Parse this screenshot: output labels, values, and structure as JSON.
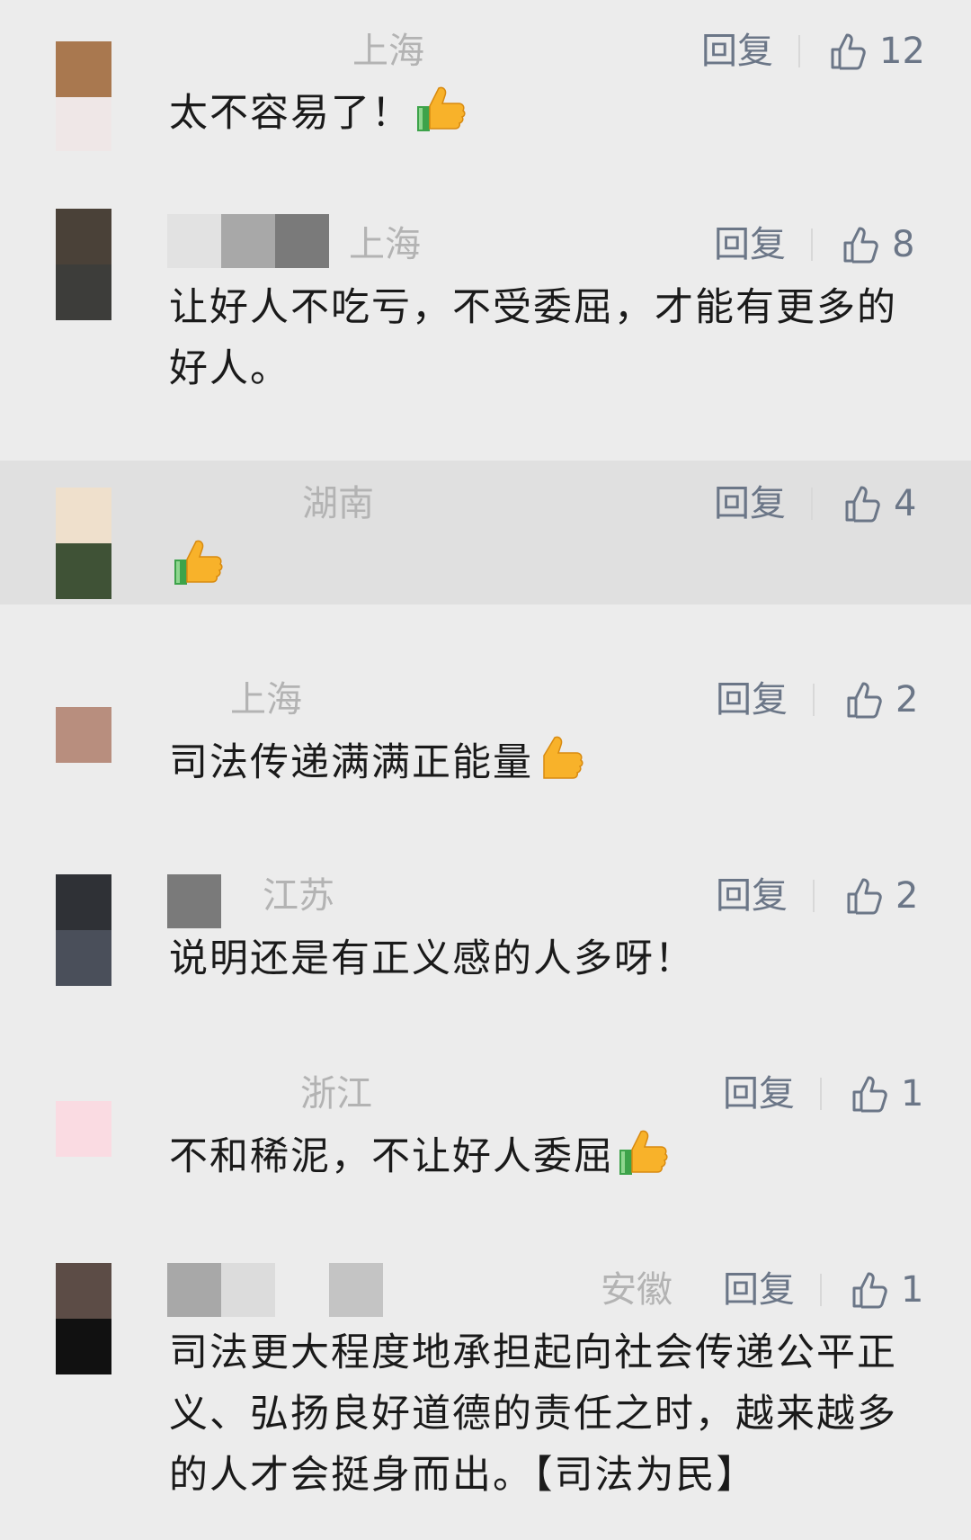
{
  "reply_label": "回复",
  "icons": {
    "like": "thumbs-up-outline-icon",
    "emoji": "thumbs-up-emoji-icon"
  },
  "colors": {
    "background": "#ececec",
    "highlight": "#e0e0e0",
    "action": "#6b7687",
    "location": "#b3b3b3",
    "text": "#1a1a1a"
  },
  "comments": [
    {
      "location": "上海",
      "likes": "12",
      "text": "太不容易了！",
      "emoji": true
    },
    {
      "location": "上海",
      "likes": "8",
      "text": "让好人不吃亏，不受委屈，才能有更多的好人。",
      "emoji": false
    },
    {
      "location": "湖南",
      "likes": "4",
      "text": "",
      "emoji": true
    },
    {
      "location": "上海",
      "likes": "2",
      "text": "司法传递满满正能量",
      "emoji": true
    },
    {
      "location": "江苏",
      "likes": "2",
      "text": "说明还是有正义感的人多呀！",
      "emoji": false
    },
    {
      "location": "浙江",
      "likes": "1",
      "text": "不和稀泥，不让好人委屈",
      "emoji": true
    },
    {
      "location": "安徽",
      "likes": "1",
      "text": "司法更大程度地承担起向社会传递公平正义、弘扬良好道德的责任之时，越来越多的人才会挺身而出。【司法为民】",
      "emoji": false
    }
  ]
}
